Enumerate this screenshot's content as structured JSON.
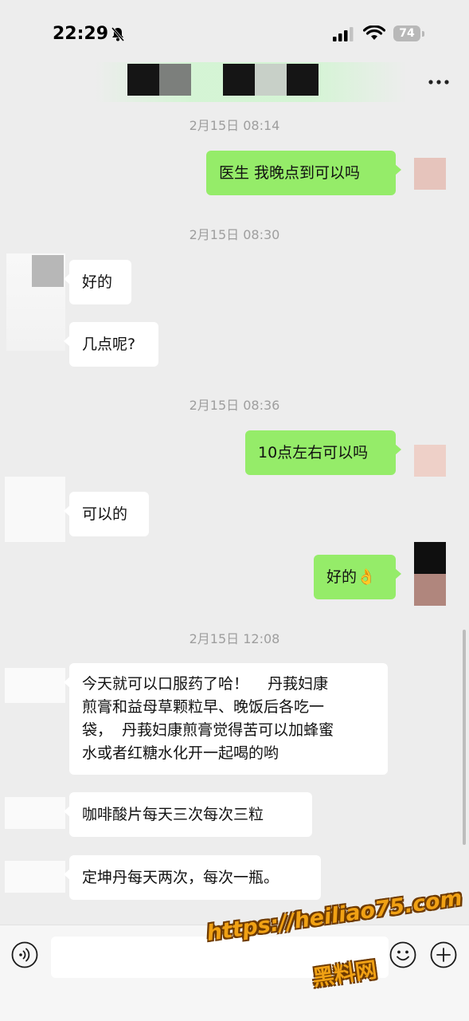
{
  "status_bar": {
    "time": "22:29",
    "battery": "74",
    "icons": [
      "bell-slash-icon",
      "cellular-signal-icon",
      "wifi-icon",
      "battery-icon"
    ]
  },
  "header": {
    "more_icon": "more-icon"
  },
  "messages": [
    {
      "type": "timestamp",
      "text": "2月15日 08:14"
    },
    {
      "type": "outgoing",
      "text": "医生 我晚点到可以吗"
    },
    {
      "type": "timestamp",
      "text": "2月15日 08:30"
    },
    {
      "type": "incoming",
      "text": "好的"
    },
    {
      "type": "incoming",
      "text": "几点呢?"
    },
    {
      "type": "timestamp",
      "text": "2月15日 08:36"
    },
    {
      "type": "outgoing",
      "text": "10点左右可以吗"
    },
    {
      "type": "incoming",
      "text": "可以的"
    },
    {
      "type": "outgoing",
      "text": "好的👌"
    },
    {
      "type": "timestamp",
      "text": "2月15日 12:08"
    },
    {
      "type": "incoming",
      "lines": [
        "今天就可以口服药了哈！    丹莪妇康",
        "煎膏和益母草颗粒早、晚饭后各吃一",
        "袋，  丹莪妇康煎膏觉得苦可以加蜂蜜",
        "水或者红糖水化开一起喝的哟"
      ]
    },
    {
      "type": "incoming",
      "text": "咖啡酸片每天三次每次三粒"
    },
    {
      "type": "incoming",
      "text": "定坤丹每天两次，每次一瓶。"
    }
  ],
  "input_bar": {
    "icons": [
      "voice-icon",
      "emoji-icon",
      "plus-icon"
    ]
  },
  "watermark": {
    "line1": "https://heiliao75.com",
    "line2": "黑料网"
  },
  "colors": {
    "background": "#ededed",
    "outgoing_bubble": "#95ec69",
    "incoming_bubble": "#ffffff",
    "timestamp": "#9e9e9e"
  }
}
